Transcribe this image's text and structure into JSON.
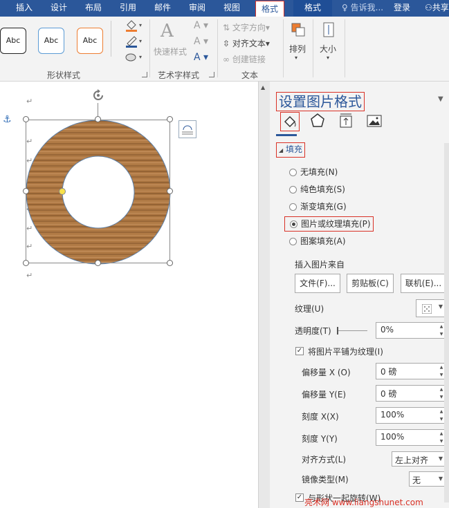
{
  "tabs": {
    "insert": "插入",
    "design": "设计",
    "layout": "布局",
    "references": "引用",
    "mailings": "邮件",
    "review": "审阅",
    "view": "视图",
    "format_active": "格式",
    "format_2": "格式",
    "tell_me": "告诉我...",
    "login": "登录",
    "share": "共享"
  },
  "ribbon": {
    "shape_styles_label": "形状样式",
    "swatch_1": "Abc",
    "swatch_2": "Abc",
    "swatch_3": "Abc",
    "quick_styles": "快速样式",
    "wordart_label": "艺术字样式",
    "text_direction": "文字方向",
    "align_text": "对齐文本",
    "create_link": "创建链接",
    "text_label": "文本",
    "arrange": "排列",
    "size": "大小",
    "colors": {
      "swatch_1_border": "#222222",
      "swatch_2_border": "#5b9bd5",
      "swatch_3_border": "#ed7d31"
    }
  },
  "pane": {
    "title": "设置图片格式",
    "fill_section": "填充",
    "fill_options": [
      {
        "label": "无填充(N)",
        "selected": false
      },
      {
        "label": "纯色填充(S)",
        "selected": false
      },
      {
        "label": "渐变填充(G)",
        "selected": false
      },
      {
        "label": "图片或纹理填充(P)",
        "selected": true
      },
      {
        "label": "图案填充(A)",
        "selected": false
      }
    ],
    "insert_from": "插入图片来自",
    "file_button": "文件(F)...",
    "clipboard_button": "剪贴板(C)",
    "online_button": "联机(E)...",
    "texture_label": "纹理(U)",
    "transparency_label": "透明度(T)",
    "transparency_value": "0%",
    "tile_label": "将图片平铺为纹理(I)",
    "tile_checked": true,
    "offset_x_label": "偏移量 X (O)",
    "offset_x_value": "0 磅",
    "offset_y_label": "偏移量 Y(E)",
    "offset_y_value": "0 磅",
    "scale_x_label": "刻度 X(X)",
    "scale_x_value": "100%",
    "scale_y_label": "刻度 Y(Y)",
    "scale_y_value": "100%",
    "alignment_label": "对齐方式(L)",
    "alignment_value": "左上对齐",
    "mirror_label": "镜像类型(M)",
    "mirror_value": "无",
    "rotate_with_shape": "与形状一起旋转(W)",
    "rotate_checked": true
  },
  "watermark": "亮术网 www.liangshunet.com"
}
